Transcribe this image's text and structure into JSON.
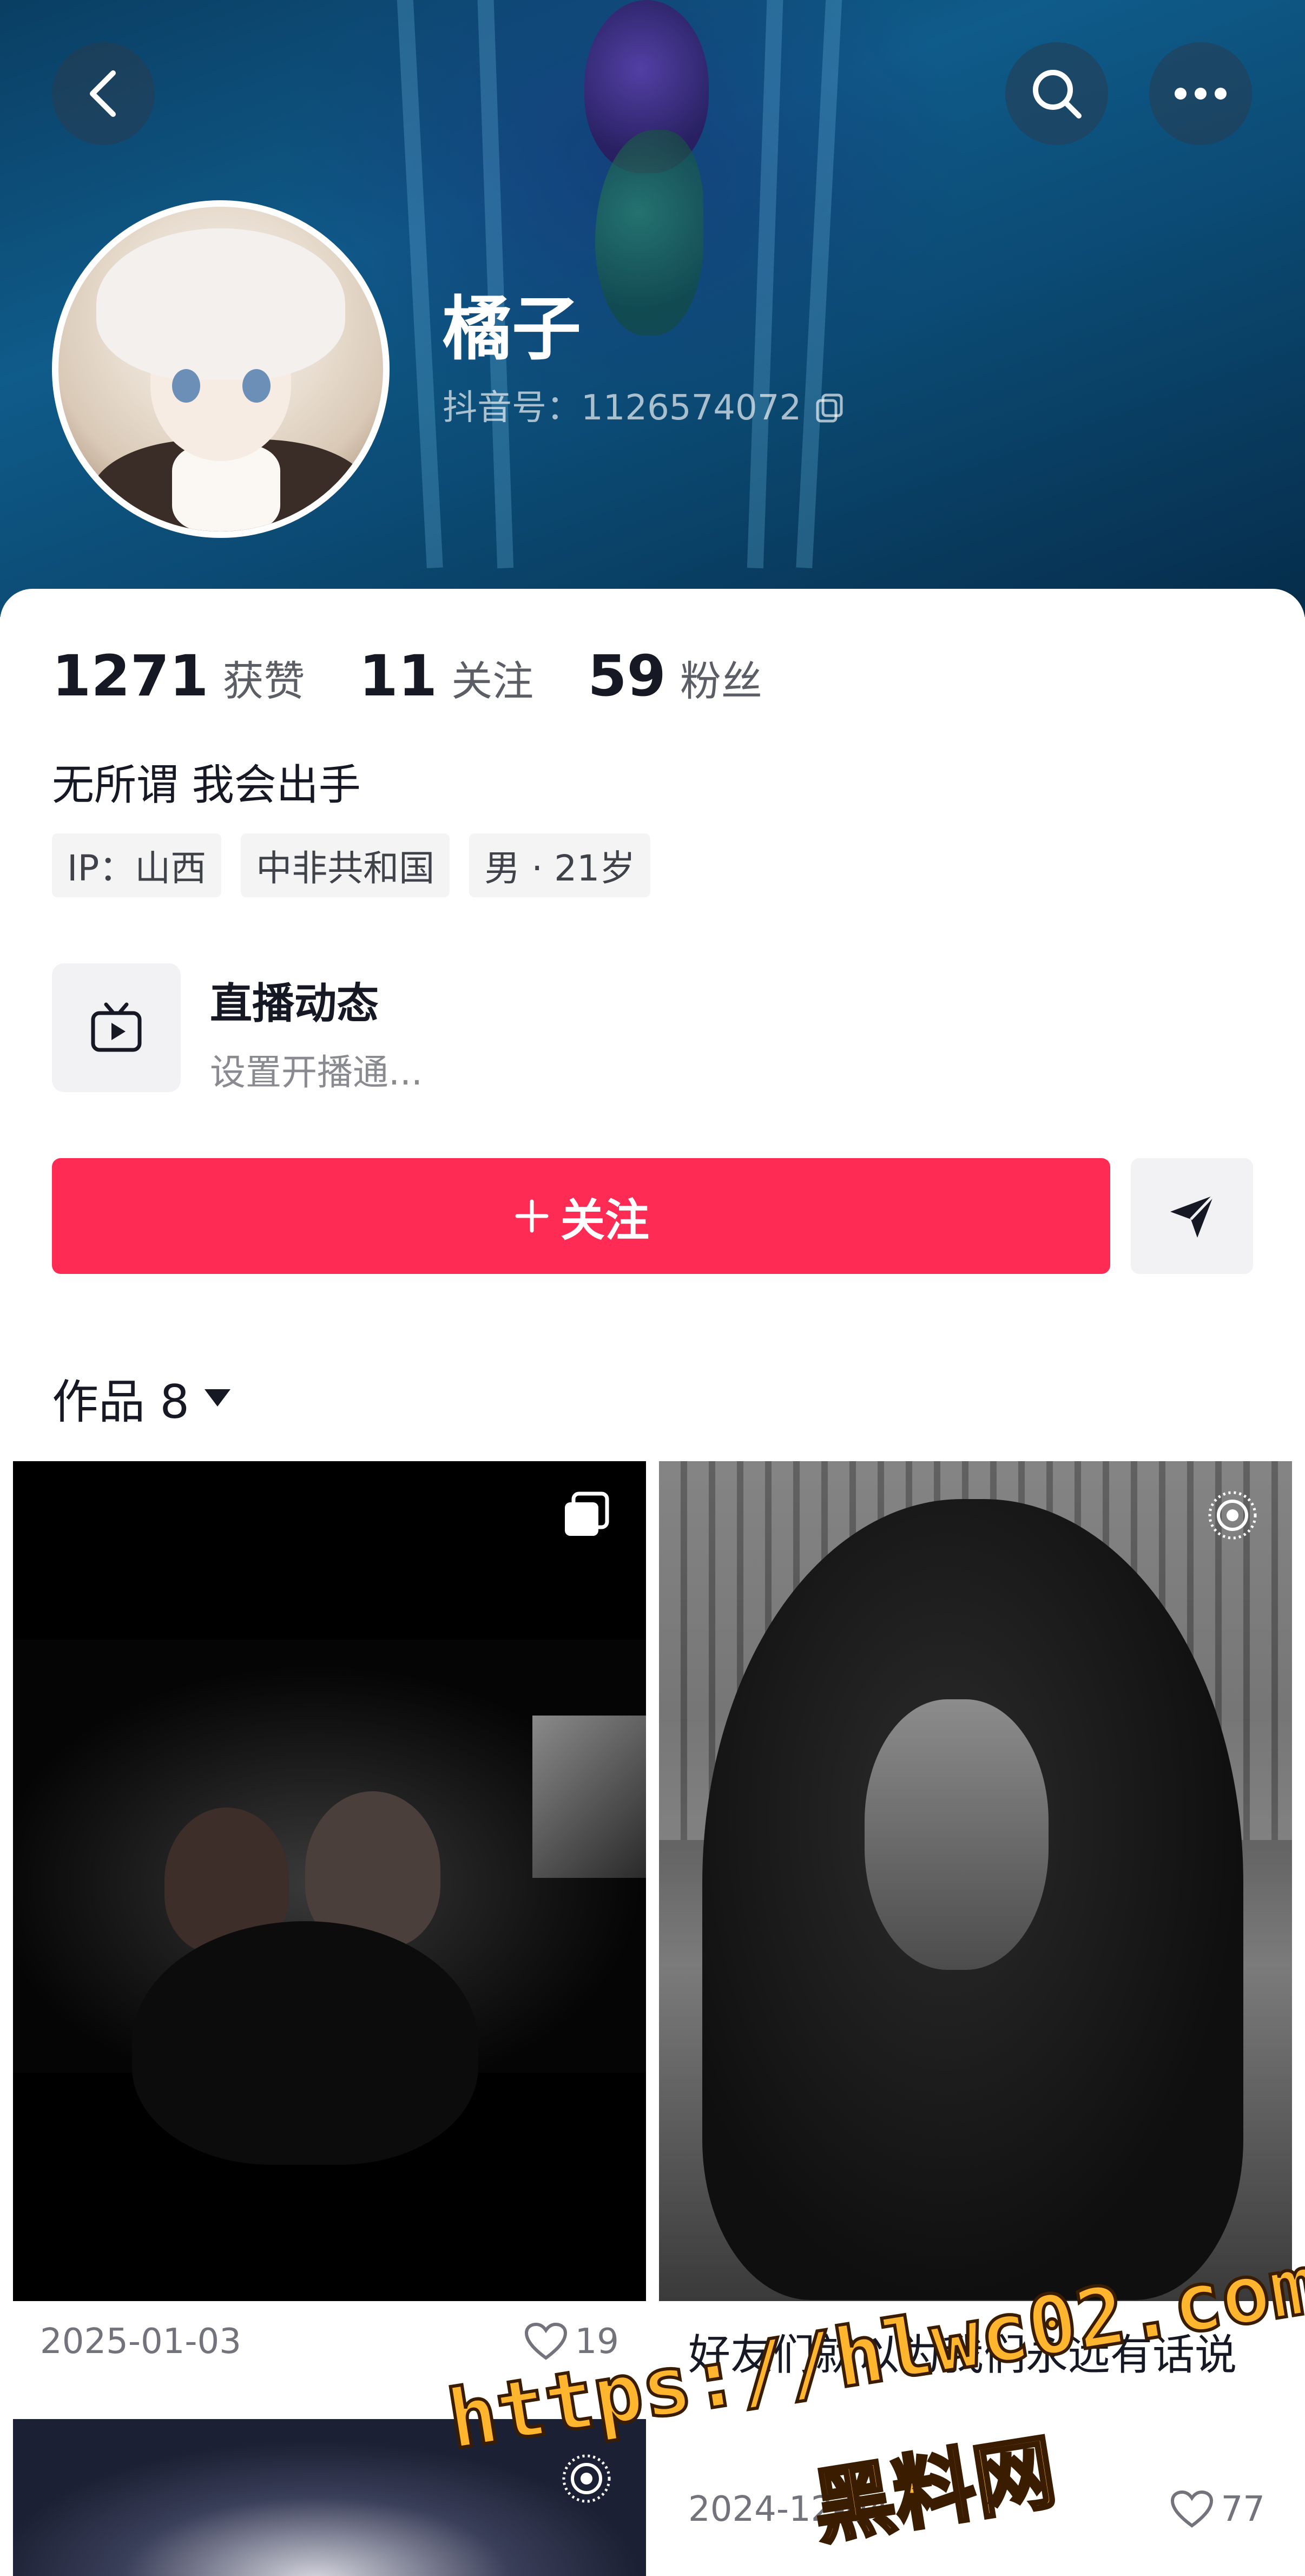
{
  "profile": {
    "nickname": "橘子",
    "douyin_id": "抖音号：1126574072",
    "bio": "无所谓 我会出手"
  },
  "stats": [
    {
      "value": "1271",
      "label": "获赞"
    },
    {
      "value": "11",
      "label": "关注"
    },
    {
      "value": "59",
      "label": "粉丝"
    }
  ],
  "tags": [
    "IP：山西",
    "中非共和国",
    "男 · 21岁"
  ],
  "live": {
    "title": "直播动态",
    "subtitle": "设置开播通..."
  },
  "actions": {
    "follow_label": "关注"
  },
  "works_tab": {
    "label": "作品 8"
  },
  "grid": [
    {
      "date": "2025-01-03",
      "likes": "19"
    },
    {
      "title": "好友们就以为我们永远有话说",
      "date": "2024-12-04",
      "likes": "77"
    }
  ],
  "watermark": {
    "line1": "https://hlwc02.com",
    "line2": "黑料网"
  },
  "colors": {
    "accent": "#fe2c55",
    "text_primary": "#161823",
    "text_secondary": "#73747b"
  },
  "icons": [
    "back-icon",
    "search-icon",
    "more-icon",
    "copy-icon",
    "tv-icon",
    "send-icon",
    "caret-down-icon",
    "multi-image-icon",
    "live-photo-icon",
    "heart-icon"
  ]
}
